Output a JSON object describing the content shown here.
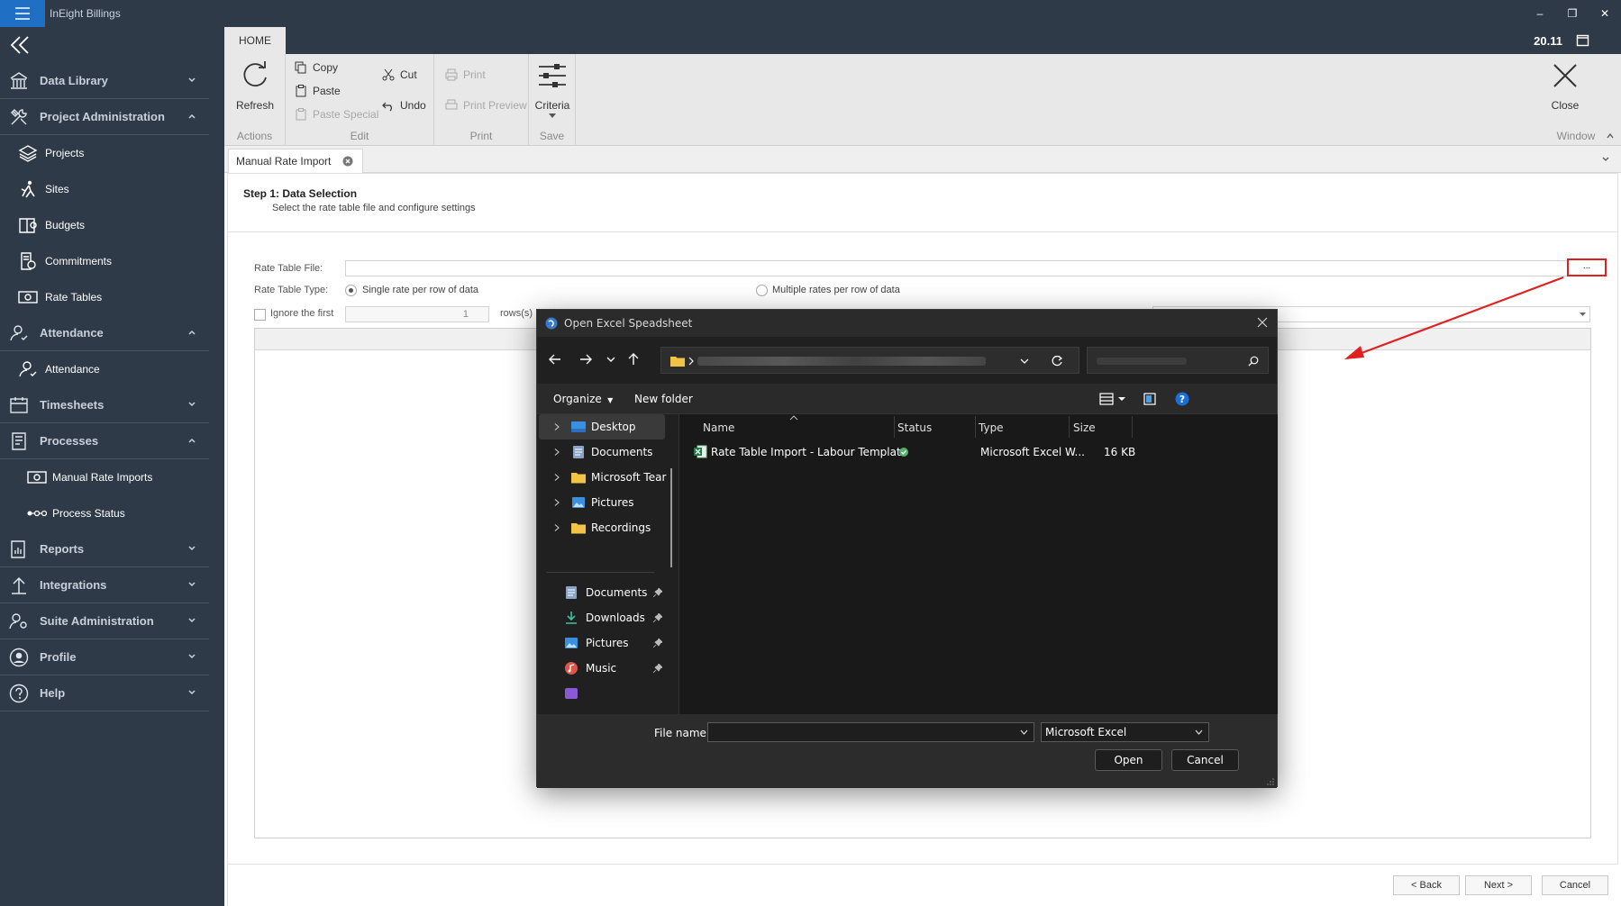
{
  "app": {
    "title": "InEight Billings",
    "version": "20.11"
  },
  "sidebar": {
    "items": [
      {
        "label": "Data Library",
        "type": "section",
        "expanded": false
      },
      {
        "label": "Project Administration",
        "type": "section",
        "expanded": true
      },
      {
        "label": "Projects",
        "type": "sub"
      },
      {
        "label": "Sites",
        "type": "sub"
      },
      {
        "label": "Budgets",
        "type": "sub"
      },
      {
        "label": "Commitments",
        "type": "sub"
      },
      {
        "label": "Rate Tables",
        "type": "sub"
      },
      {
        "label": "Attendance",
        "type": "section",
        "expanded": true
      },
      {
        "label": "Attendance",
        "type": "sub"
      },
      {
        "label": "Timesheets",
        "type": "section",
        "expanded": false
      },
      {
        "label": "Processes",
        "type": "section",
        "expanded": true
      },
      {
        "label": "Manual Rate Imports",
        "type": "sub"
      },
      {
        "label": "Process Status",
        "type": "sub"
      },
      {
        "label": "Reports",
        "type": "section",
        "expanded": false
      },
      {
        "label": "Integrations",
        "type": "section",
        "expanded": false
      },
      {
        "label": "Suite Administration",
        "type": "section",
        "expanded": false
      },
      {
        "label": "Profile",
        "type": "section",
        "expanded": false
      },
      {
        "label": "Help",
        "type": "section",
        "expanded": false
      }
    ]
  },
  "ribbon": {
    "tab": "HOME",
    "refresh": "Refresh",
    "copy": "Copy",
    "paste": "Paste",
    "paste_special": "Paste Special",
    "cut": "Cut",
    "undo": "Undo",
    "print": "Print",
    "print_preview": "Print Preview",
    "criteria": "Criteria",
    "close": "Close",
    "groups": {
      "actions": "Actions",
      "edit": "Edit",
      "print": "Print",
      "save": "Save",
      "window": "Window"
    }
  },
  "doc_tab": {
    "label": "Manual Rate Import"
  },
  "step": {
    "title": "Step 1: Data Selection",
    "subtitle": "Select the rate table file and configure settings"
  },
  "form": {
    "rate_table_file_label": "Rate Table File:",
    "browse_label": "...",
    "rate_table_type_label": "Rate Table Type:",
    "radio_single": "Single rate per row of data",
    "radio_multiple": "Multiple rates per row of data",
    "ignore_label": "Ignore the first",
    "ignore_value": "1",
    "rows_label": "rows(s)"
  },
  "wizard": {
    "back": "< Back",
    "next": "Next >",
    "cancel": "Cancel"
  },
  "dialog": {
    "title": "Open Excel Speadsheet",
    "organize": "Organize",
    "new_folder": "New folder",
    "tree": [
      "Desktop",
      "Documents",
      "Microsoft Tear",
      "Pictures",
      "Recordings"
    ],
    "quick_access": [
      "Documents",
      "Downloads",
      "Pictures",
      "Music"
    ],
    "columns": {
      "name": "Name",
      "status": "Status",
      "type": "Type",
      "size": "Size"
    },
    "files": [
      {
        "name": "Rate Table Import - Labour Template",
        "type": "Microsoft Excel W...",
        "size": "16 KB"
      }
    ],
    "file_name_label": "File name:",
    "file_type": "Microsoft Excel",
    "open": "Open",
    "cancel": "Cancel"
  },
  "colors": {
    "sidebar_bg": "#2f3a48",
    "accent_blue": "#1f6fc4",
    "highlight_red": "#e02020",
    "dialog_bg": "#202020"
  }
}
